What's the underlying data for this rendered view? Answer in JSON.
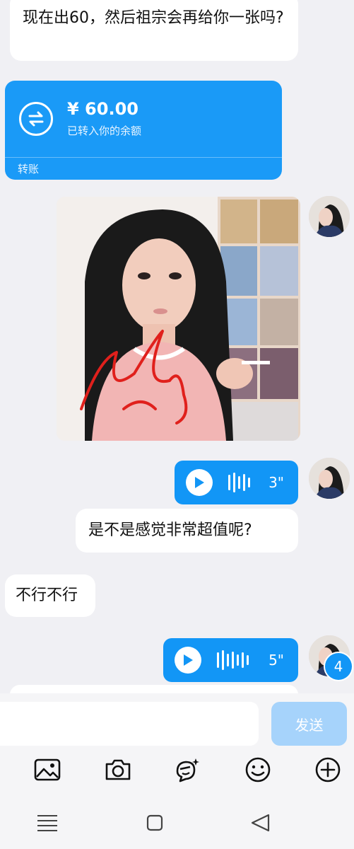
{
  "messages": {
    "top_text": "现在出60，然后祖宗会再给你一张吗?",
    "transfer": {
      "amount": "¥ 60.00",
      "status": "已转入你的余额",
      "footer": "转账",
      "icon": "transfer-arrows-icon"
    },
    "photo_desc": "",
    "voice1_duration": "3\"",
    "question": "是不是感觉非常超值呢?",
    "reply": "不行不行",
    "voice2_duration": "5\""
  },
  "unread_badge": "4",
  "composer": {
    "input_placeholder": "",
    "send_label": "发送"
  },
  "toolbar_icons": [
    "image-icon",
    "camera-icon",
    "sticker-icon",
    "emoji-icon",
    "plus-icon"
  ],
  "navbar_icons": [
    "menu-icon",
    "home-icon",
    "back-icon"
  ],
  "colors": {
    "accent": "#1296f6",
    "send_disabled": "#a6d3fb",
    "background": "#f0f0f4"
  }
}
